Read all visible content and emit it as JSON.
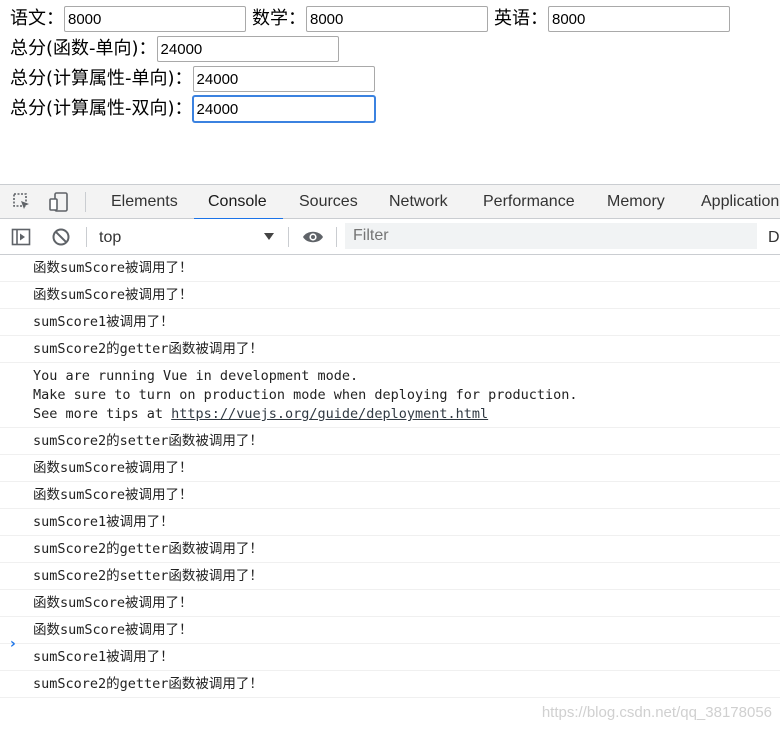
{
  "form": {
    "chinese_label": "语文：",
    "chinese_value": "8000",
    "math_label": "数学：",
    "math_value": "8000",
    "english_label": "英语：",
    "english_value": "8000",
    "total_fn_label": "总分(函数-单向)：",
    "total_fn_value": "24000",
    "total_computed_one_way_label": "总分(计算属性-单向)：",
    "total_computed_one_way_value": "24000",
    "total_computed_two_way_label": "总分(计算属性-双向)：",
    "total_computed_two_way_value": "24000"
  },
  "devtools": {
    "tabs": [
      "Elements",
      "Console",
      "Sources",
      "Network",
      "Performance",
      "Memory",
      "Application"
    ],
    "active_tab": "Console",
    "context": "top",
    "filter_placeholder": "Filter",
    "truncated_label": "D",
    "accent_color": "#1a73e8"
  },
  "console": {
    "messages": [
      {
        "lines": [
          "函数sumScore被调用了！"
        ]
      },
      {
        "lines": [
          "函数sumScore被调用了！"
        ]
      },
      {
        "lines": [
          "sumScore1被调用了！"
        ]
      },
      {
        "lines": [
          "sumScore2的getter函数被调用了！"
        ]
      },
      {
        "lines": [
          "You are running Vue in development mode.",
          "Make sure to turn on production mode when deploying for production.",
          "See more tips at "
        ],
        "link": "https://vuejs.org/guide/deployment.html"
      },
      {
        "lines": [
          "sumScore2的setter函数被调用了！"
        ]
      },
      {
        "lines": [
          "函数sumScore被调用了！"
        ]
      },
      {
        "lines": [
          "函数sumScore被调用了！"
        ]
      },
      {
        "lines": [
          "sumScore1被调用了！"
        ]
      },
      {
        "lines": [
          "sumScore2的getter函数被调用了！"
        ]
      },
      {
        "lines": [
          "sumScore2的setter函数被调用了！"
        ]
      },
      {
        "lines": [
          "函数sumScore被调用了！"
        ]
      },
      {
        "lines": [
          "函数sumScore被调用了！"
        ]
      },
      {
        "lines": [
          "sumScore1被调用了！"
        ]
      },
      {
        "lines": [
          "sumScore2的getter函数被调用了！"
        ]
      }
    ],
    "prompt_symbol": "›"
  },
  "watermark": "https://blog.csdn.net/qq_38178056"
}
